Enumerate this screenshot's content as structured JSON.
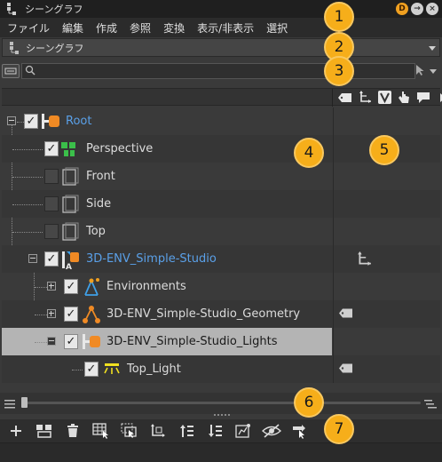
{
  "window": {
    "title": "シーングラフ",
    "buttons": [
      "D",
      "→",
      "×"
    ]
  },
  "menubar": {
    "items": [
      "ファイル",
      "編集",
      "作成",
      "参照",
      "変換",
      "表示/非表示",
      "選択"
    ]
  },
  "scene_selector": {
    "value": "シーングラフ"
  },
  "search": {
    "value": "",
    "placeholder": ""
  },
  "tree": {
    "nodes": [
      {
        "label": "Root",
        "checked": true,
        "color": "blue"
      },
      {
        "label": "Perspective",
        "checked": true,
        "color": "normal"
      },
      {
        "label": "Front",
        "checked": false,
        "color": "normal"
      },
      {
        "label": "Side",
        "checked": false,
        "color": "normal"
      },
      {
        "label": "Top",
        "checked": false,
        "color": "normal"
      },
      {
        "label": "3D-ENV_Simple-Studio",
        "checked": true,
        "color": "blue"
      },
      {
        "label": "Environments",
        "checked": true,
        "color": "normal"
      },
      {
        "label": "3D-ENV_Simple-Studio_Geometry",
        "checked": true,
        "color": "normal"
      },
      {
        "label": "3D-ENV_Simple-Studio_Lights",
        "checked": true,
        "color": "dark",
        "selected": true
      },
      {
        "label": "Top_Light",
        "checked": true,
        "color": "normal"
      }
    ]
  },
  "callouts": [
    "1",
    "2",
    "3",
    "4",
    "5",
    "6",
    "7"
  ],
  "colors": {
    "accent_orange": "#f6ae1a",
    "link_blue": "#5aa0e8",
    "selection_gray": "#b4b4b4"
  }
}
